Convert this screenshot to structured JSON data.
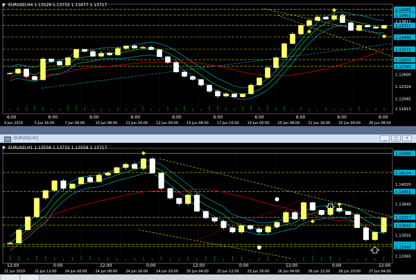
{
  "colors": {
    "background": "#000000",
    "grid": "#1e3344",
    "axis_text": "#ffffff",
    "bull_candle": "#ffff66",
    "bear_candle": "#ffffff",
    "bollinger": "#00aac8",
    "ma_fast": "#00c040",
    "ma_slow": "#c00000",
    "level_line": "#ffff00",
    "diamond": "#ffee00",
    "price_label_bg": "#00b4d8",
    "volume": "#00a000"
  },
  "window_top": {
    "title": "EURUSD,H4  1.13529 1.13732 1.13477 1.13717",
    "chart_data": {
      "type": "candlestick",
      "symbol": "EURUSD",
      "timeframe": "H4",
      "ohlc_info": [
        "1.13529",
        "1.13732",
        "1.13477",
        "1.13717"
      ],
      "price_labels": [
        "1.14085",
        "1.13951",
        "1.13811",
        "1.13717",
        "1.13448",
        "1.13172",
        "1.12933",
        "1.12780",
        "1.12600",
        "1.12324",
        "1.12045",
        "1.11815"
      ],
      "highlight_labels": [
        "1.14085",
        "1.13951",
        "1.13717",
        "1.13448",
        "1.13172",
        "1.12933",
        "1.12780"
      ],
      "ylim": [
        1.1176,
        1.1414
      ],
      "xaxis_labels": [
        "4 Jun 2019",
        "5 Jun 16:00",
        "7 Jun 00:00",
        "10 Jun 08:00",
        "11 Jun 16:00",
        "12 Jun 00:00",
        "14 Jun 08:00",
        "17 Jun 16:00",
        "19 Jun 00:00",
        "20 Jun 08:00",
        "21 Jun 16:00",
        "25 Jun 00:00",
        "26 Jun 08:00"
      ],
      "session_labels": [
        "6:00",
        "6:00",
        "6:00",
        "6:00",
        "6:00",
        "6:00",
        "6:00",
        "6:00",
        "6:00",
        "6:00"
      ],
      "close_path": [
        1.1262,
        1.1272,
        1.1255,
        1.1247,
        1.1295,
        1.1289,
        1.1281,
        1.1298,
        1.1317,
        1.1312,
        1.1301,
        1.1308,
        1.1304,
        1.1319,
        1.1325,
        1.132,
        1.1322,
        1.1316,
        1.13,
        1.1287,
        1.1265,
        1.1255,
        1.1248,
        1.1235,
        1.1221,
        1.121,
        1.1215,
        1.1208,
        1.1215,
        1.1235,
        1.1252,
        1.1275,
        1.1298,
        1.133,
        1.1352,
        1.1372,
        1.1383,
        1.1391,
        1.1386,
        1.1394,
        1.1378,
        1.136,
        1.1372,
        1.1368,
        1.1365,
        1.1372
      ],
      "diamonds": [
        "peak",
        "high",
        "low",
        "low"
      ],
      "ylabel": ""
    }
  },
  "window_bottom": {
    "title": "EURUSD,H1  1.13558 1.13732 1.13558 1.13717",
    "window_title": "EURUSD,H1",
    "buttons": [
      "_",
      "□",
      "×"
    ],
    "chart_data": {
      "type": "candlestick",
      "symbol": "EURUSD",
      "timeframe": "H1",
      "ohlc_info": [
        "1.13558",
        "1.13732",
        "1.13558",
        "1.13717"
      ],
      "price_labels": [
        "1.14300",
        "1.14124",
        "1.14020",
        "1.13951",
        "1.13840",
        "1.13717",
        "1.13643",
        "1.13555",
        "1.13469",
        "1.13448",
        "1.13365"
      ],
      "highlight_labels": [
        "1.14300",
        "1.14124",
        "1.13951",
        "1.13717",
        "1.13643",
        "1.13469",
        "1.13448"
      ],
      "ylim": [
        1.1332,
        1.1432
      ],
      "xaxis_labels": [
        "21 Jun 2019",
        "21 Jun 12:00",
        "24 Jun 00:00",
        "24 Jun 08:00",
        "24 Jun 16:00",
        "24 Jun 20:00",
        "25 Jun 04:00",
        "25 Jun 12:00",
        "25 Jun 20:00",
        "26 Jun 04:00",
        "26 Jun 12:00",
        "26 Jun 20:00",
        "27 Jun 04:00"
      ],
      "session_labels": [
        "12:00",
        "0:00",
        "12:00",
        "0:00",
        "12:00",
        "0:00",
        "12:00",
        "0:00",
        "12:00"
      ],
      "close_path": [
        1.1348,
        1.136,
        1.1372,
        1.1389,
        1.1396,
        1.1405,
        1.1398,
        1.1402,
        1.1408,
        1.1404,
        1.141,
        1.1412,
        1.1417,
        1.142,
        1.1416,
        1.1425,
        1.1412,
        1.1398,
        1.1389,
        1.1384,
        1.1392,
        1.1377,
        1.1371,
        1.1368,
        1.1362,
        1.1358,
        1.1364,
        1.1361,
        1.1358,
        1.1363,
        1.1367,
        1.1376,
        1.137,
        1.1385,
        1.1378,
        1.1374,
        1.138,
        1.1377,
        1.1374,
        1.1362,
        1.1351,
        1.1358,
        1.1371
      ],
      "diamonds": [
        "peak",
        "high",
        "low"
      ],
      "arrows": [
        "down",
        "up"
      ],
      "ylabel": ""
    }
  }
}
